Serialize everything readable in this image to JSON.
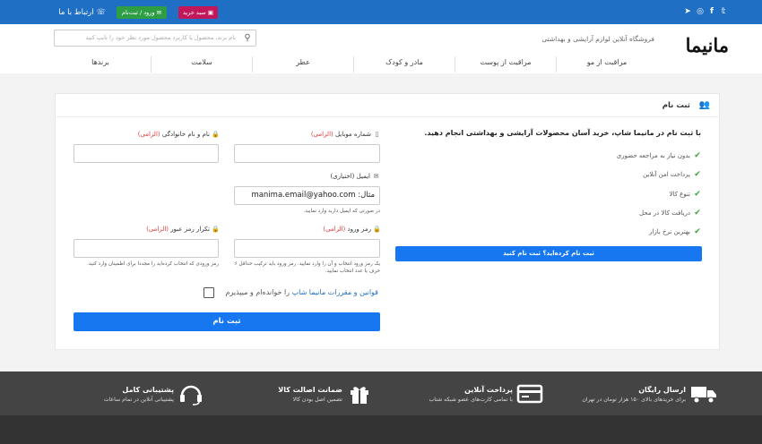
{
  "topbar": {
    "social": [
      "twitter-icon",
      "facebook-icon",
      "instagram-icon",
      "telegram-icon"
    ],
    "social_glyphs": [
      "𝕥",
      "f",
      "◎",
      "➤"
    ],
    "cart_label": "سبد خرید",
    "cart_icon": "▣",
    "login_label": "ورود / ثبت‌نام",
    "login_icon": "✉",
    "contact_label": "ارتباط با ما",
    "contact_icon": "☏"
  },
  "header": {
    "logo": "مانیما",
    "tagline": "فروشگاه آنلاین لوازم آرایشی و بهداشتی",
    "search_placeholder": "نام برند، محصول یا کاربرد محصول مورد نظر خود را تایپ کنید",
    "search_icon": "⚲",
    "nav": [
      "مراقبت از مو",
      "مراقبت از پوست",
      "مادر و کودک",
      "عطر",
      "سلامت",
      "برندها"
    ]
  },
  "card": {
    "title": "ثبت نام",
    "title_icon": "👥",
    "benefits_title": "با ثبت نام در مانیما شاپ، خرید آسان محصولات آرایشی و بهداشتی انجام دهید.",
    "benefits": [
      "بدون نیاز به مراجعه حضوری",
      "پرداخت امن آنلاین",
      "تنوع کالا",
      "دریافت کالا در محل",
      "بهترین نرخ بازار"
    ],
    "check_glyph": "✔",
    "login_prompt": "ثبت نام کرده‌اید؟ ثبت نام کنید"
  },
  "form": {
    "required_mark": "(الزامی)",
    "optional_mark": "(اختیاری)",
    "lock_glyph": "🔒",
    "mobile_glyph": "▯",
    "mail_glyph": "✉",
    "name_label": "نام و نام خانوادگی",
    "mobile_label": "شماره موبایل",
    "email_label": "ایمیل",
    "email_value": "مثال: manima.email@yahoo.com",
    "email_help": "در صورتی که ایمیل دارید وارد نمایید.",
    "password_label": "رمز ورود",
    "password_help": "یک رمز ورود انتخاب و آن را وارد نمایید. رمز ورود باید ترکیب حداقل ۶ حرف یا عدد انتخاب نمایید.",
    "confirm_label": "تکرار رمز عبور",
    "confirm_help": "رمز ورودی که انتخاب کرده‌اید را مجددا برای اطمینان وارد کنید.",
    "terms_link": "قوانین و مقررات مانیما شاپ",
    "terms_suffix": " را خوانده‌ام و میپذیرم",
    "submit": "ثبت نام"
  },
  "footer": {
    "items": [
      {
        "title": "ارسال رایگان",
        "sub": "برای خریدهای بالای ۱۵۰ هزار تومان در تهران",
        "icon": "truck-icon"
      },
      {
        "title": "پرداخت آنلاین",
        "sub": "با تمامی کارت‌های عضو شبکه شتاب",
        "icon": "card-icon"
      },
      {
        "title": "ضمانت اصالت کالا",
        "sub": "تضمین اصل بودن کالا",
        "icon": "gift-icon"
      },
      {
        "title": "پشتیبانی کامل",
        "sub": "پشتیبانی آنلاین در تمام ساعات",
        "icon": "headset-icon"
      }
    ]
  },
  "colors": {
    "primary": "#1677f0",
    "topbar": "#1f6fc4",
    "cart": "#c2185b",
    "login": "#2e9e44",
    "footer": "#444444"
  }
}
